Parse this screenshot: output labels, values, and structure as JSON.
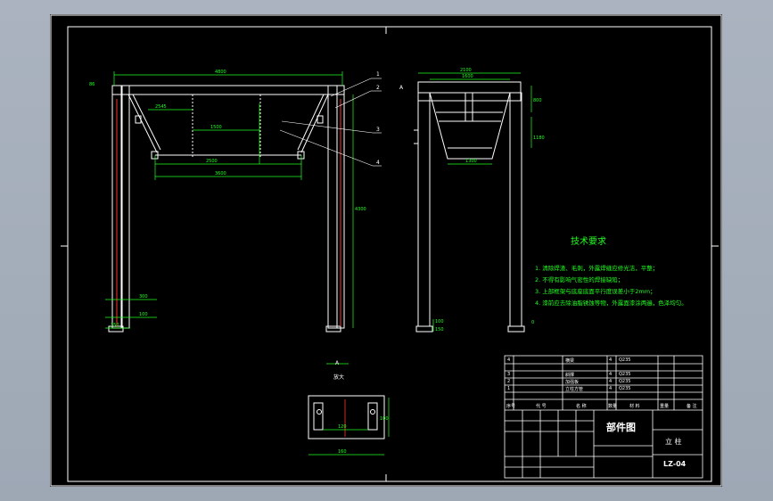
{
  "tech": {
    "title": "技术要求",
    "items": [
      "1. 清除焊渣、毛刺，外露焊缝应修光洁，平整；",
      "2. 不得有影响气密性的焊接缺陷；",
      "3. 上部框架与底座底面平行度误差小于2mm；",
      "4. 漆前应去除油脂锈蚀等物，外露面漆涂两遍，色泽均匀。"
    ]
  },
  "detail": {
    "tag": "A",
    "scale": "放大"
  },
  "balloons": [
    "1",
    "2",
    "3",
    "4"
  ],
  "side_tag": "A",
  "title_block": {
    "drawing_kind": "部件图",
    "part_name": "立 柱",
    "drawing_no": "LZ-04",
    "bom_rows": [
      {
        "no": "4",
        "name": "横梁",
        "qty": "4",
        "mat": "Q235"
      },
      {
        "no": "3",
        "name": "斜撑",
        "qty": "4",
        "mat": "Q235"
      },
      {
        "no": "2",
        "name": "加强板",
        "qty": "4",
        "mat": "Q235"
      },
      {
        "no": "1",
        "name": "立柱方管",
        "qty": "4",
        "mat": "Q235"
      }
    ]
  },
  "colors": {
    "outline": "#ffffff",
    "dimension": "#22ff22",
    "hidden": "#ff3030",
    "leader": "#ffffff"
  }
}
